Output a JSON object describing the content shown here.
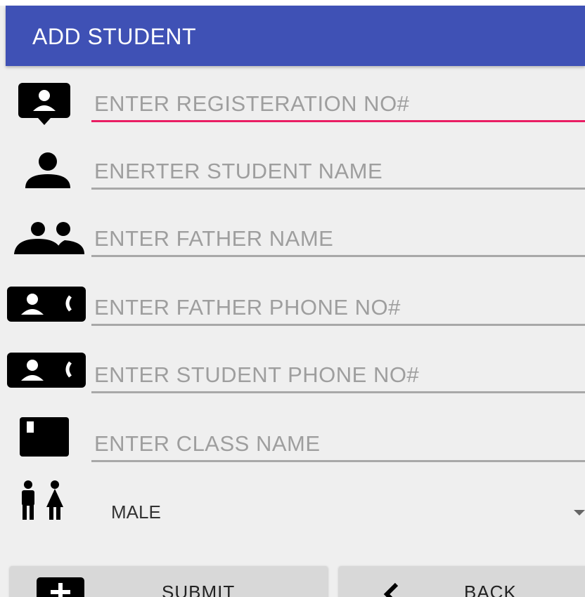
{
  "app_bar": {
    "title": "ADD STUDENT",
    "color": "#3f51b5"
  },
  "form": {
    "fields": [
      {
        "icon": "contact-badge-icon",
        "placeholder": "ENTER REGISTERATION NO#",
        "value": "",
        "focused": true
      },
      {
        "icon": "person-icon",
        "placeholder": "ENERTER STUDENT NAME",
        "value": ""
      },
      {
        "icon": "people-icon",
        "placeholder": "ENTER FATHER NAME",
        "value": ""
      },
      {
        "icon": "contact-phone-icon",
        "placeholder": "ENTER FATHER PHONE NO#",
        "value": ""
      },
      {
        "icon": "contact-phone-icon",
        "placeholder": "ENTER STUDENT PHONE NO#",
        "value": ""
      },
      {
        "icon": "class-book-icon",
        "placeholder": "ENTER CLASS NAME",
        "value": ""
      }
    ],
    "gender": {
      "icon": "wc-icon",
      "selected": "MALE"
    },
    "focus_color": "#e91e63"
  },
  "buttons": {
    "submit": {
      "label": "SUBMIT",
      "icon": "add-box-icon"
    },
    "back": {
      "label": "BACK",
      "icon": "chevron-left-icon"
    }
  }
}
